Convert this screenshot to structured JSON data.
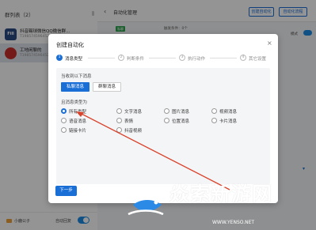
{
  "app": {
    "group_list_title": "群列表（2）",
    "groups": [
      {
        "avatar_text": "Fill",
        "name": "抖音踢球微信QQ微信群...",
        "sub": "T198574596452S"
      },
      {
        "avatar_text": "",
        "name": "工地闲聊的",
        "sub": "T198574596452S"
      }
    ],
    "footer": {
      "account": "小鹿公子",
      "auto_reply_label": "自动回复"
    },
    "right": {
      "back": "‹",
      "title": "自动化管理",
      "create_btn": "创建自动化",
      "create_btn2": "自动化流程",
      "row_tag": "私聊",
      "row_meta": "触发条件：0个",
      "mode_label": "模式",
      "dropdown": "▾"
    }
  },
  "modal": {
    "title": "创建自动化",
    "close": "×",
    "steps": [
      {
        "num": "1",
        "label": "消息类型",
        "active": true
      },
      {
        "num": "2",
        "label": "判断条件",
        "active": false
      },
      {
        "num": "3",
        "label": "执行动作",
        "active": false
      },
      {
        "num": "4",
        "label": "其它设置",
        "active": false
      }
    ],
    "receive_label": "当收到以下消息",
    "receive_options": [
      "私聊消息",
      "群聊消息"
    ],
    "type_label": "且消息类型为",
    "types": [
      [
        "所有类型",
        "文字消息",
        "图片消息",
        "视频消息"
      ],
      [
        "语音消息",
        "表情",
        "位置消息",
        "卡片消息"
      ],
      [
        "链接卡片",
        "抖音视频"
      ]
    ],
    "selected_type": "所有类型",
    "next_btn": "下一步"
  },
  "watermark": {
    "text": "焱索新游网",
    "url": "WWW.YENSO.NET"
  },
  "colors": {
    "accent": "#1a6fd6",
    "annotation_arrow": "#d9432c"
  }
}
